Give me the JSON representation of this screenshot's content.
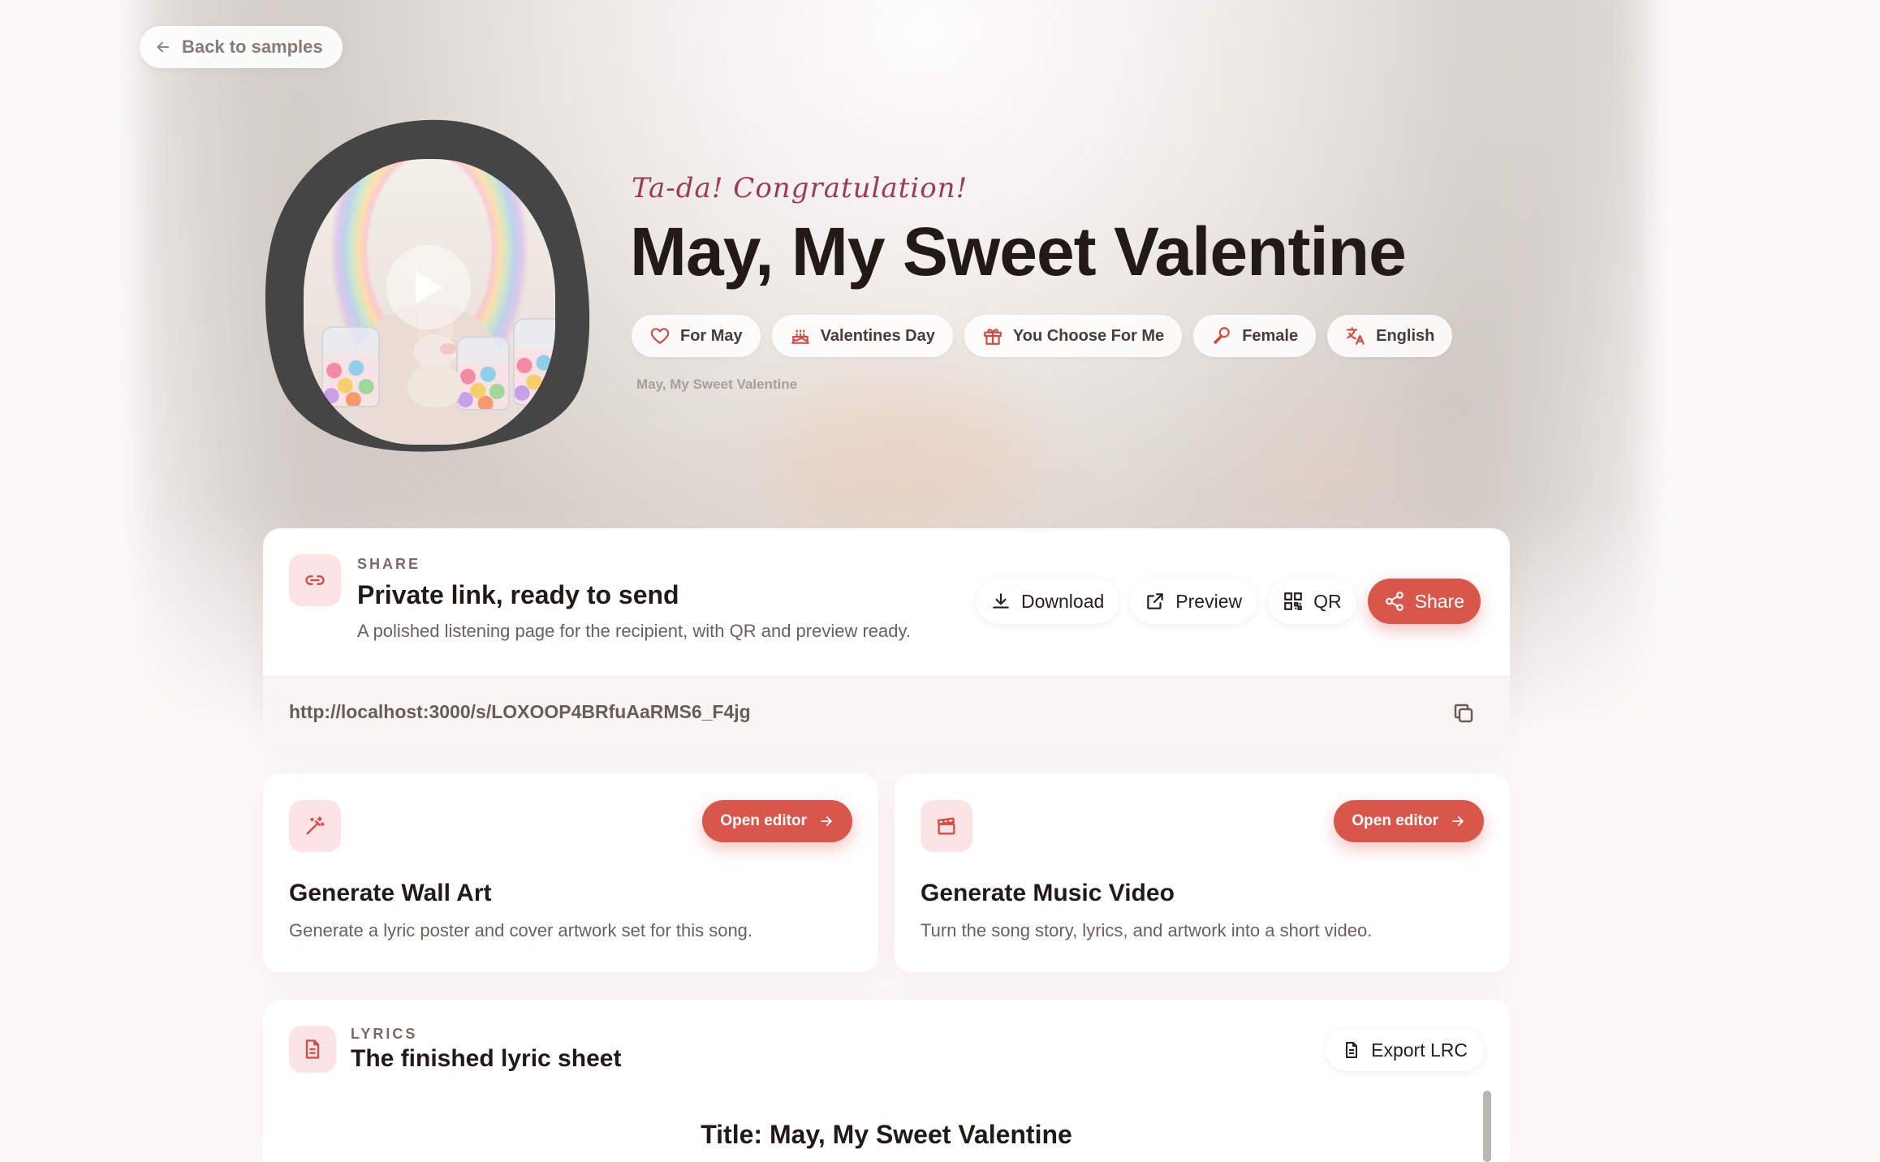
{
  "nav": {
    "back_label": "Back to samples"
  },
  "hero": {
    "congrats": "Ta-da! Congratulation!",
    "title": "May, My Sweet Valentine",
    "chips": [
      {
        "icon": "heart-icon",
        "label": "For May"
      },
      {
        "icon": "cake-icon",
        "label": "Valentines Day"
      },
      {
        "icon": "gift-icon",
        "label": "You Choose For Me"
      },
      {
        "icon": "microphone-icon",
        "label": "Female"
      },
      {
        "icon": "translate-icon",
        "label": "English"
      }
    ],
    "subtitle": "May, My Sweet Valentine"
  },
  "share": {
    "eyebrow": "SHARE",
    "title": "Private link, ready to send",
    "description": "A polished listening page for the recipient, with QR and preview ready.",
    "actions": {
      "download": "Download",
      "preview": "Preview",
      "qr": "QR",
      "share": "Share"
    },
    "url": "http://localhost:3000/s/LOXOOP4BRfuAaRMS6_F4jg"
  },
  "features": [
    {
      "icon": "magic-wand-icon",
      "button": "Open editor",
      "title": "Generate Wall Art",
      "description": "Generate a lyric poster and cover artwork set for this song."
    },
    {
      "icon": "clapperboard-icon",
      "button": "Open editor",
      "title": "Generate Music Video",
      "description": "Turn the song story, lyrics, and artwork into a short video."
    }
  ],
  "lyrics": {
    "eyebrow": "LYRICS",
    "title": "The finished lyric sheet",
    "export_label": "Export LRC",
    "first_line": "Title: May, My Sweet Valentine"
  },
  "colors": {
    "accent": "#d9564b",
    "accent_soft": "#fbe3e6",
    "title": "#231a18",
    "congrats": "#9b3b58"
  }
}
